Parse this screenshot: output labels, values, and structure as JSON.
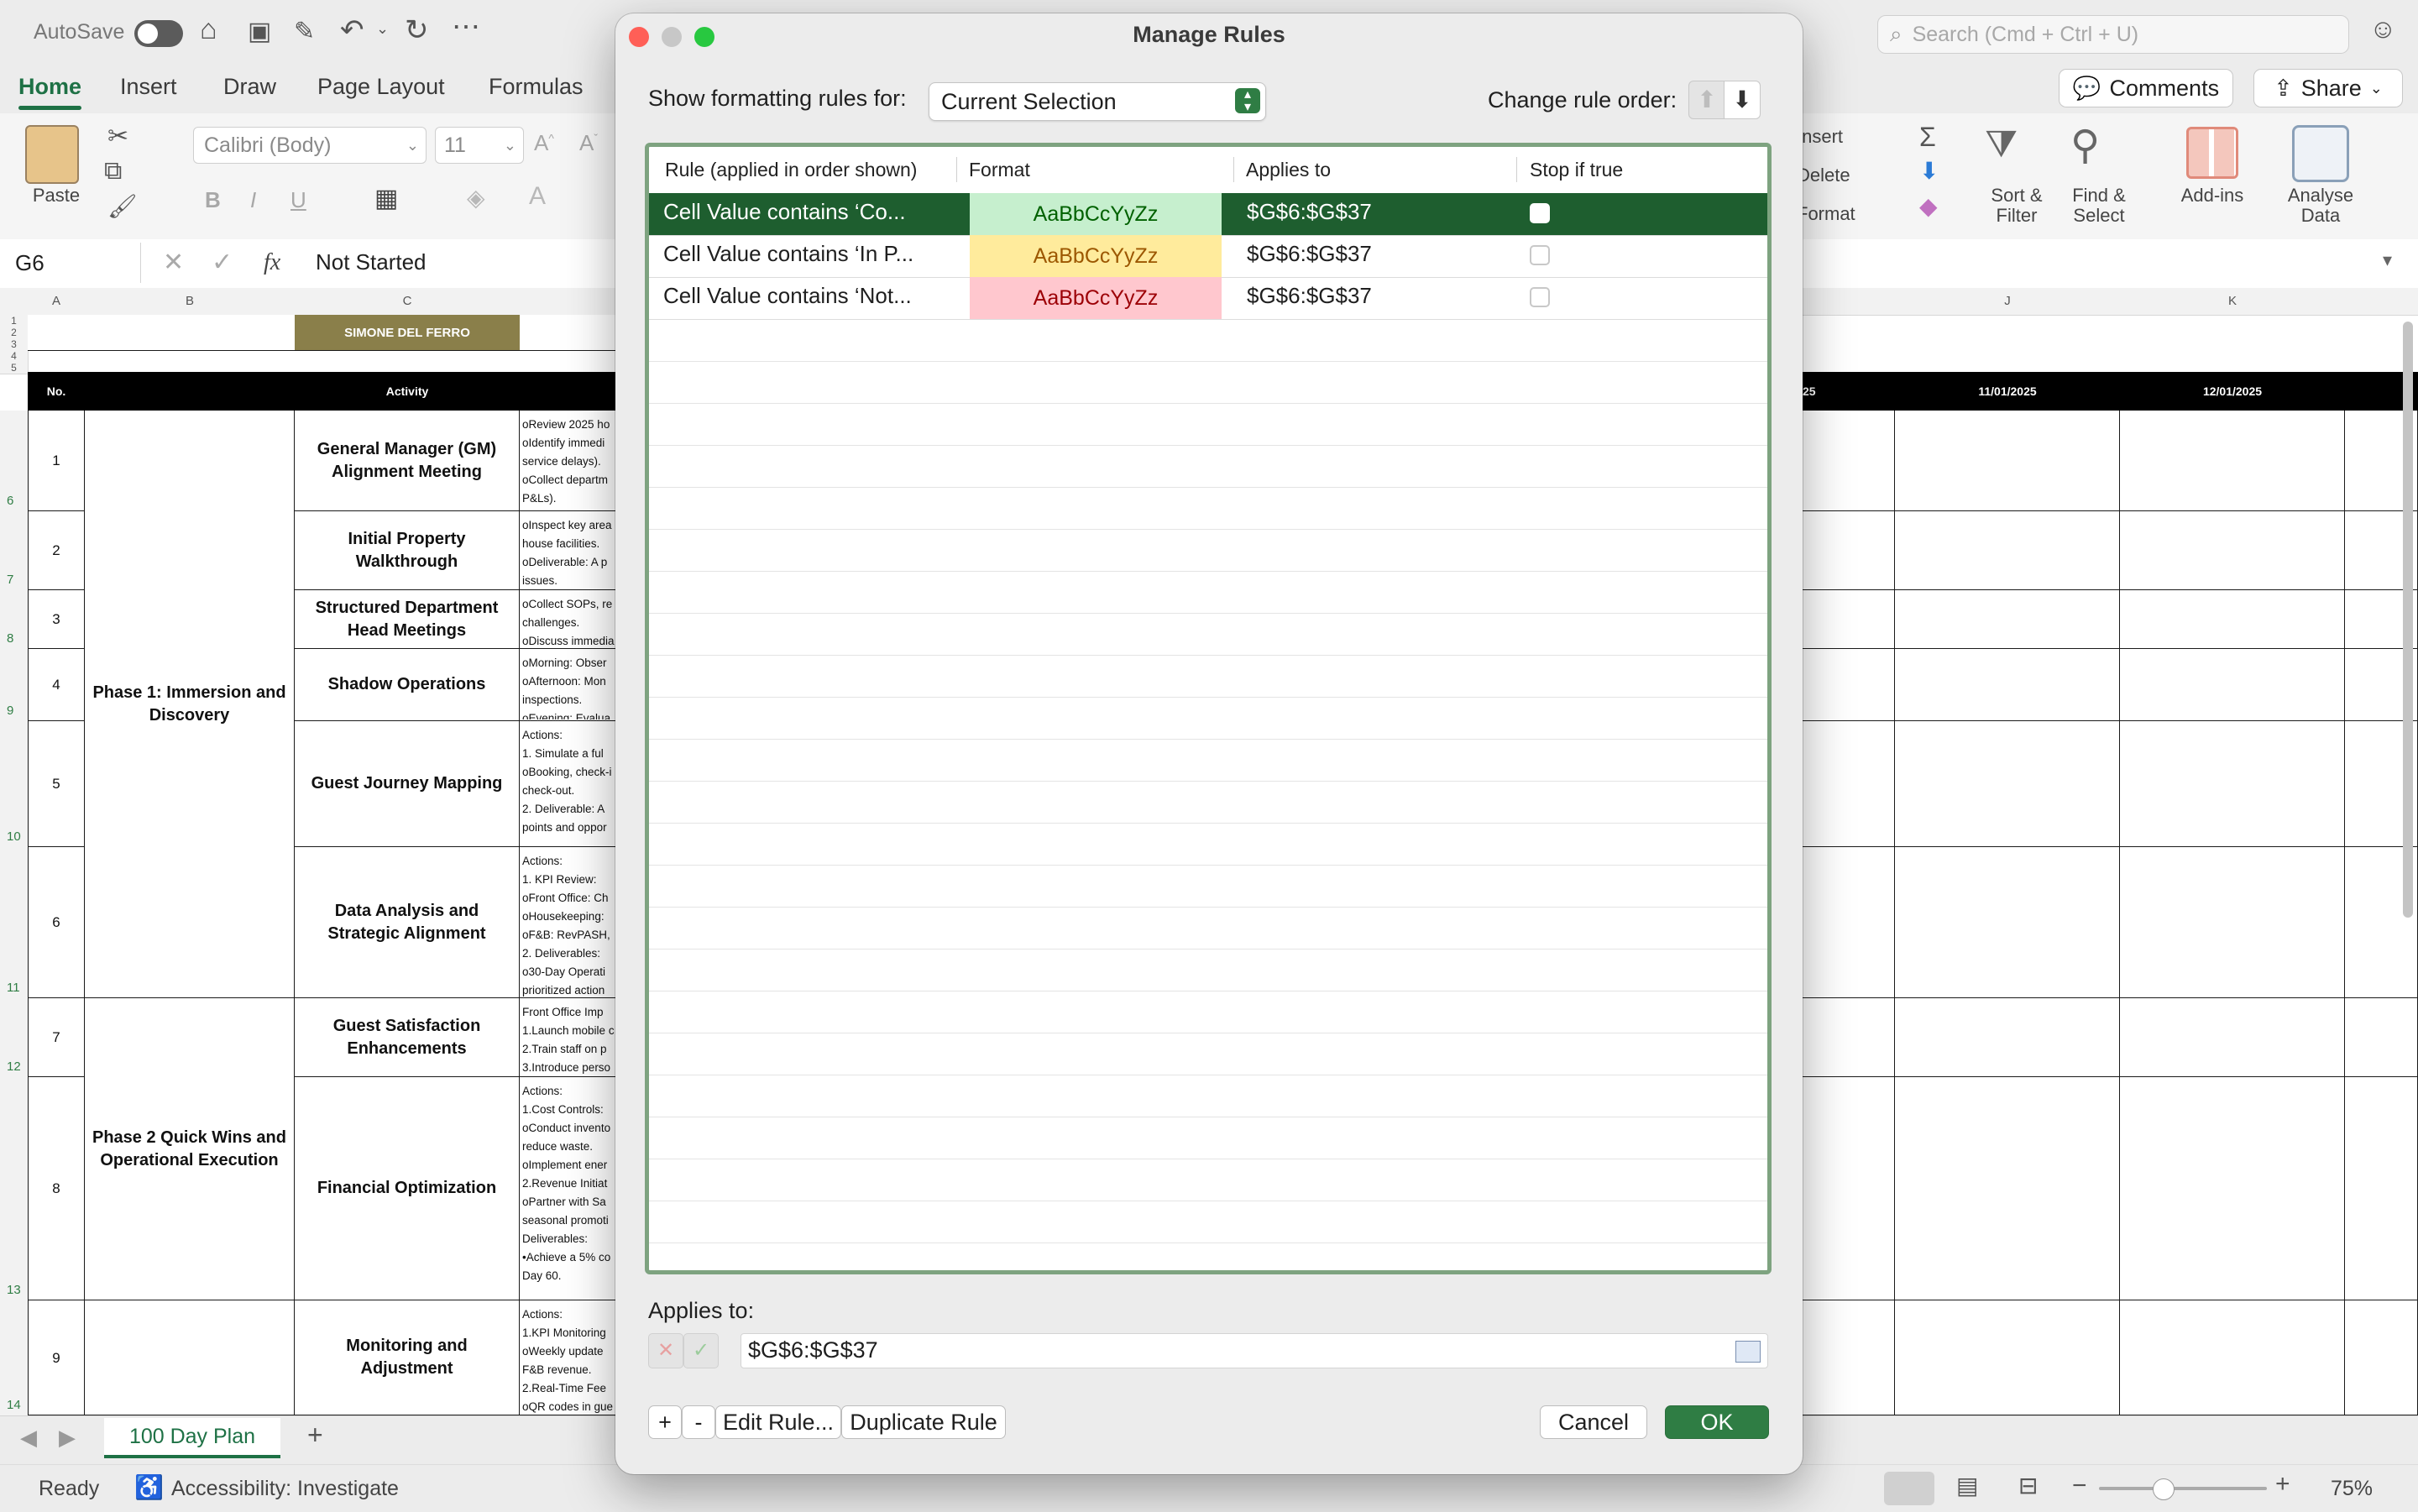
{
  "titlebar": {
    "autosave_label": "AutoSave",
    "search_placeholder": "Search (Cmd + Ctrl + U)"
  },
  "ribbon_tabs": [
    "Home",
    "Insert",
    "Draw",
    "Page Layout",
    "Formulas"
  ],
  "ribbon": {
    "paste_label": "Paste",
    "font_name": "Calibri (Body)",
    "font_size": "11",
    "bold": "B",
    "italic": "I",
    "underline": "U",
    "insert_label": "Insert",
    "delete_label": "Delete",
    "format_label": "Format",
    "sort_filter_label": "Sort &\nFilter",
    "find_select_label": "Find &\nSelect",
    "addins_label": "Add-ins",
    "analyse_label": "Analyse\nData",
    "comments_label": "Comments",
    "share_label": "Share"
  },
  "formula_bar": {
    "cell_ref": "G6",
    "fx": "fx",
    "value": "Not Started"
  },
  "sheet": {
    "col_headers": [
      "A",
      "B",
      "C",
      "J",
      "K"
    ],
    "owner_name": "SIMONE DEL FERRO",
    "header_no": "No.",
    "header_activity": "Activity",
    "header_dates": [
      "25",
      "11/01/2025",
      "12/01/2025"
    ],
    "row_numbers": [
      "1",
      "2",
      "3",
      "4",
      "5",
      "6",
      "7",
      "8",
      "9",
      "10",
      "11",
      "12",
      "13",
      "14"
    ],
    "phases": [
      "Phase 1: Immersion and Discovery",
      "Phase 2 Quick Wins and Operational Execution"
    ],
    "activities": [
      {
        "no": "1",
        "name": "General Manager (GM) Alignment Meeting",
        "desc": [
          "oReview 2025 ho",
          "oIdentify immedi",
          "service delays).",
          "oCollect departm",
          "P&Ls)."
        ]
      },
      {
        "no": "2",
        "name": "Initial Property Walkthrough",
        "desc": [
          "oInspect key area",
          "house facilities.",
          "oDeliverable: A p",
          "issues."
        ]
      },
      {
        "no": "3",
        "name": "Structured Department Head Meetings",
        "desc": [
          "oCollect SOPs, re",
          "challenges.",
          "oDiscuss immedia"
        ]
      },
      {
        "no": "4",
        "name": "Shadow Operations",
        "desc": [
          "oMorning: Obser",
          "oAfternoon: Mon",
          "inspections.",
          "oEvening: Evalua"
        ]
      },
      {
        "no": "5",
        "name": "Guest Journey Mapping",
        "desc": [
          " Actions:",
          "1. Simulate a ful",
          "oBooking, check-i",
          "check-out.",
          "2. Deliverable: A",
          "points and oppor"
        ]
      },
      {
        "no": "6",
        "name": "Data Analysis and Strategic Alignment",
        "desc": [
          "Actions:",
          "1. KPI Review:",
          "oFront Office: Ch",
          "oHousekeeping: ",
          "oF&B: RevPASH,",
          "2. Deliverables:",
          "o30-Day Operati",
          "prioritized action"
        ]
      },
      {
        "no": "7",
        "name": "Guest Satisfaction Enhancements",
        "desc": [
          "Front Office Imp",
          "1.Launch mobile c",
          "2.Train staff on p",
          "3.Introduce perso"
        ]
      },
      {
        "no": "8",
        "name": "Financial Optimization",
        "desc": [
          "Actions:",
          "1.Cost Controls:",
          "oConduct invento",
          "reduce waste.",
          "oImplement ener",
          "2.Revenue Initiat",
          "oPartner with Sa",
          "seasonal promoti",
          "Deliverables:",
          "•Achieve a 5% co",
          "Day 60."
        ]
      },
      {
        "no": "9",
        "name": "Monitoring and Adjustment",
        "desc": [
          "Actions:",
          "1.KPI Monitoring",
          "oWeekly update",
          "F&B revenue.",
          "2.Real-Time Fee",
          "oQR codes in gue"
        ]
      }
    ],
    "left_row_labels": [
      "6",
      "7",
      "8",
      "9",
      "10",
      "11",
      "12",
      "13",
      "14"
    ]
  },
  "sheet_tabs": {
    "active": "100 Day Plan",
    "add": "+"
  },
  "statusbar": {
    "ready": "Ready",
    "accessibility": "Accessibility: Investigate",
    "zoom": "75%"
  },
  "dialog": {
    "title": "Manage Rules",
    "show_rules_label": "Show formatting rules for:",
    "show_rules_value": "Current Selection",
    "change_order_label": "Change rule order:",
    "columns": [
      "Rule (applied in order shown)",
      "Format",
      "Applies to",
      "Stop if true"
    ],
    "rules": [
      {
        "rule": "Cell Value contains ‘Co...",
        "format": "AaBbCcYyZz",
        "applies_to": "$G$6:$G$37",
        "stop_if_true": false,
        "fmt_bg": "#c6efce",
        "fmt_color": "#006100",
        "selected": true
      },
      {
        "rule": "Cell Value contains ‘In P...",
        "format": "AaBbCcYyZz",
        "applies_to": "$G$6:$G$37",
        "stop_if_true": false,
        "fmt_bg": "#ffeb9c",
        "fmt_color": "#9c5700",
        "selected": false
      },
      {
        "rule": "Cell Value contains ‘Not...",
        "format": "AaBbCcYyZz",
        "applies_to": "$G$6:$G$37",
        "stop_if_true": false,
        "fmt_bg": "#ffc7ce",
        "fmt_color": "#9c0006",
        "selected": false
      }
    ],
    "applies_to_label": "Applies to:",
    "applies_to_value": "$G$6:$G$37",
    "add_button": "+",
    "remove_button": "-",
    "edit_button": "Edit Rule...",
    "duplicate_button": "Duplicate Rule",
    "cancel_button": "Cancel",
    "ok_button": "OK"
  },
  "colors": {
    "accent": "#1e7145",
    "selected_row": "#1e5e2f",
    "ok_button": "#2f7d44",
    "owner_header": "#8a7f4a"
  }
}
